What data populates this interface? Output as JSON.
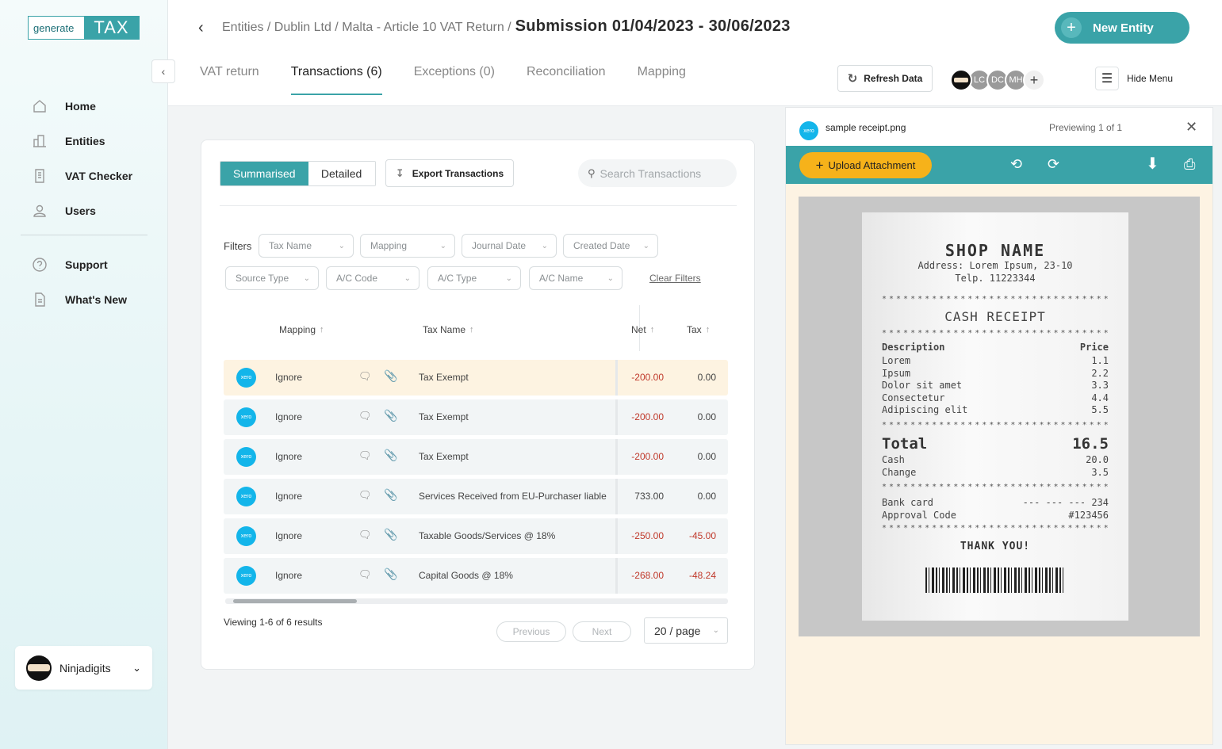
{
  "sidebar": {
    "logo_left": "generate",
    "logo_right": "TAX",
    "nav": [
      {
        "label": "Home",
        "icon": "home-icon"
      },
      {
        "label": "Entities",
        "icon": "building-icon"
      },
      {
        "label": "VAT Checker",
        "icon": "document-icon"
      },
      {
        "label": "Users",
        "icon": "user-icon"
      }
    ],
    "nav2": [
      {
        "label": "Support",
        "icon": "help-icon"
      },
      {
        "label": "What's New",
        "icon": "file-icon"
      }
    ],
    "org": "Ninjadigits"
  },
  "header": {
    "breadcrumb": "Entities / Dublin Ltd / Malta - Article 10 VAT Return /",
    "current": "Submission 01/04/2023 - 30/06/2023",
    "new_entity": "New Entity",
    "tabs": [
      "VAT return",
      "Transactions (6)",
      "Exceptions (0)",
      "Reconciliation",
      "Mapping"
    ],
    "refresh": "Refresh Data",
    "avatars": [
      "LC",
      "DC",
      "MH"
    ],
    "hide_menu": "Hide Menu"
  },
  "toolbar": {
    "summarised": "Summarised",
    "detailed": "Detailed",
    "export": "Export Transactions",
    "search_placeholder": "Search Transactions"
  },
  "filters": {
    "label": "Filters",
    "row1": [
      "Tax Name",
      "Mapping",
      "Journal Date",
      "Created Date"
    ],
    "row2": [
      "Source Type",
      "A/C Code",
      "A/C Type",
      "A/C Name"
    ],
    "clear": "Clear Filters"
  },
  "table": {
    "headers": {
      "mapping": "Mapping",
      "tax_name": "Tax Name",
      "net": "Net",
      "tax": "Tax"
    },
    "source_badge": "xero",
    "rows": [
      {
        "mapping": "Ignore",
        "tax_name": "Tax Exempt",
        "net": "-200.00",
        "tax": "0.00"
      },
      {
        "mapping": "Ignore",
        "tax_name": "Tax Exempt",
        "net": "-200.00",
        "tax": "0.00"
      },
      {
        "mapping": "Ignore",
        "tax_name": "Tax Exempt",
        "net": "-200.00",
        "tax": "0.00"
      },
      {
        "mapping": "Ignore",
        "tax_name": "Services Received from EU-Purchaser liable",
        "net": "733.00",
        "tax": "0.00"
      },
      {
        "mapping": "Ignore",
        "tax_name": "Taxable Goods/Services @ 18%",
        "net": "-250.00",
        "tax": "-45.00"
      },
      {
        "mapping": "Ignore",
        "tax_name": "Capital Goods @ 18%",
        "net": "-268.00",
        "tax": "-48.24"
      }
    ]
  },
  "pagination": {
    "viewing": "Viewing 1-6 of 6 results",
    "previous": "Previous",
    "next": "Next",
    "per_page": "20 / page"
  },
  "preview": {
    "file_name": "sample receipt.png",
    "count": "Previewing 1 of 1",
    "upload": "Upload Attachment",
    "receipt": {
      "shop": "SHOP NAME",
      "address": "Address: Lorem Ipsum, 23-10",
      "telp": "Telp. 11223344",
      "title": "CASH RECEIPT",
      "desc_h": "Description",
      "price_h": "Price",
      "items": [
        {
          "name": "Lorem",
          "price": "1.1"
        },
        {
          "name": "Ipsum",
          "price": "2.2"
        },
        {
          "name": "Dolor sit amet",
          "price": "3.3"
        },
        {
          "name": "Consectetur",
          "price": "4.4"
        },
        {
          "name": "Adipiscing elit",
          "price": "5.5"
        }
      ],
      "total_l": "Total",
      "total": "16.5",
      "cash_l": "Cash",
      "cash": "20.0",
      "change_l": "Change",
      "change": "3.5",
      "bank_l": "Bank card",
      "bank": "--- --- --- 234",
      "approval_l": "Approval Code",
      "approval": "#123456",
      "thanks": "THANK YOU!"
    }
  },
  "colors": {
    "accent": "#3aa3a8",
    "negative": "#c0392b",
    "upload": "#f6b21a",
    "xero": "#13b5ea"
  }
}
